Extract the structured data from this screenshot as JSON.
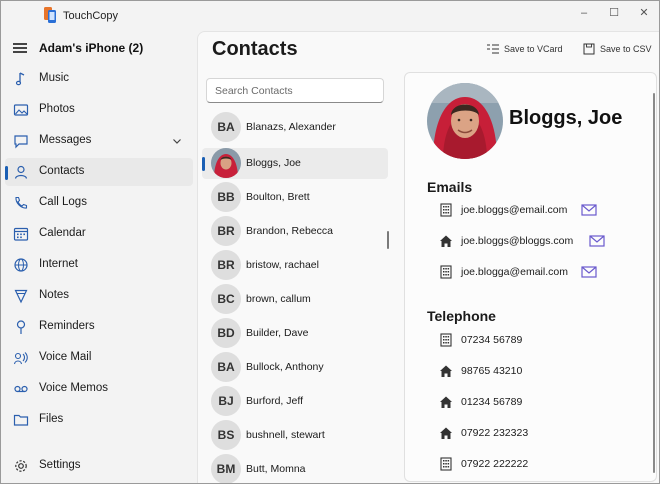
{
  "app": {
    "title": "TouchCopy",
    "device": "Adam's iPhone (2)"
  },
  "window_controls": {
    "minimize": "–",
    "maximize": "☐",
    "close": "✕"
  },
  "nav": [
    {
      "label": "Music",
      "icon": "music-note-icon"
    },
    {
      "label": "Photos",
      "icon": "photo-icon"
    },
    {
      "label": "Messages",
      "icon": "message-bubble-icon"
    },
    {
      "label": "Contacts",
      "icon": "person-icon"
    },
    {
      "label": "Call Logs",
      "icon": "phone-icon"
    },
    {
      "label": "Calendar",
      "icon": "calendar-icon"
    },
    {
      "label": "Internet",
      "icon": "globe-icon"
    },
    {
      "label": "Notes",
      "icon": "notes-icon"
    },
    {
      "label": "Reminders",
      "icon": "pin-icon"
    },
    {
      "label": "Voice Mail",
      "icon": "voicemail-icon"
    },
    {
      "label": "Voice Memos",
      "icon": "tape-icon"
    },
    {
      "label": "Files",
      "icon": "folder-icon"
    }
  ],
  "settings_label": "Settings",
  "page": {
    "title": "Contacts"
  },
  "toolbar": {
    "save_vcard": "Save to VCard",
    "save_csv": "Save to CSV"
  },
  "search": {
    "placeholder": "Search Contacts",
    "value": ""
  },
  "contacts": [
    {
      "initials": "BA",
      "name": "Blanazs, Alexander"
    },
    {
      "initials": "",
      "name": "Bloggs, Joe"
    },
    {
      "initials": "BB",
      "name": "Boulton, Brett"
    },
    {
      "initials": "BR",
      "name": "Brandon, Rebecca"
    },
    {
      "initials": "BR",
      "name": "bristow, rachael"
    },
    {
      "initials": "BC",
      "name": "brown, callum"
    },
    {
      "initials": "BD",
      "name": "Builder, Dave"
    },
    {
      "initials": "BA",
      "name": "Bullock, Anthony"
    },
    {
      "initials": "BJ",
      "name": "Burford, Jeff"
    },
    {
      "initials": "BS",
      "name": "bushnell, stewart"
    },
    {
      "initials": "BM",
      "name": "Butt, Momna"
    }
  ],
  "selected_contact": {
    "name": "Bloggs, Joe",
    "emails_title": "Emails",
    "emails": [
      {
        "value": "joe.bloggs@email.com",
        "type_icon": "office-building-icon"
      },
      {
        "value": "joe.bloggs@bloggs.com",
        "type_icon": "home-icon"
      },
      {
        "value": "joe.blogga@email.com",
        "type_icon": "office-building-icon"
      }
    ],
    "telephone_title": "Telephone",
    "phones": [
      {
        "value": "07234 56789",
        "type_icon": "office-building-icon"
      },
      {
        "value": "98765 43210",
        "type_icon": "home-icon"
      },
      {
        "value": "01234 56789",
        "type_icon": "home-icon"
      },
      {
        "value": "07922 232323",
        "type_icon": "home-icon"
      },
      {
        "value": "07922 222222",
        "type_icon": "office-building-icon"
      }
    ]
  },
  "colors": {
    "accent": "#1a5fb4",
    "mail_icon": "#6a5acd",
    "avatar_bg": "#dedede"
  }
}
